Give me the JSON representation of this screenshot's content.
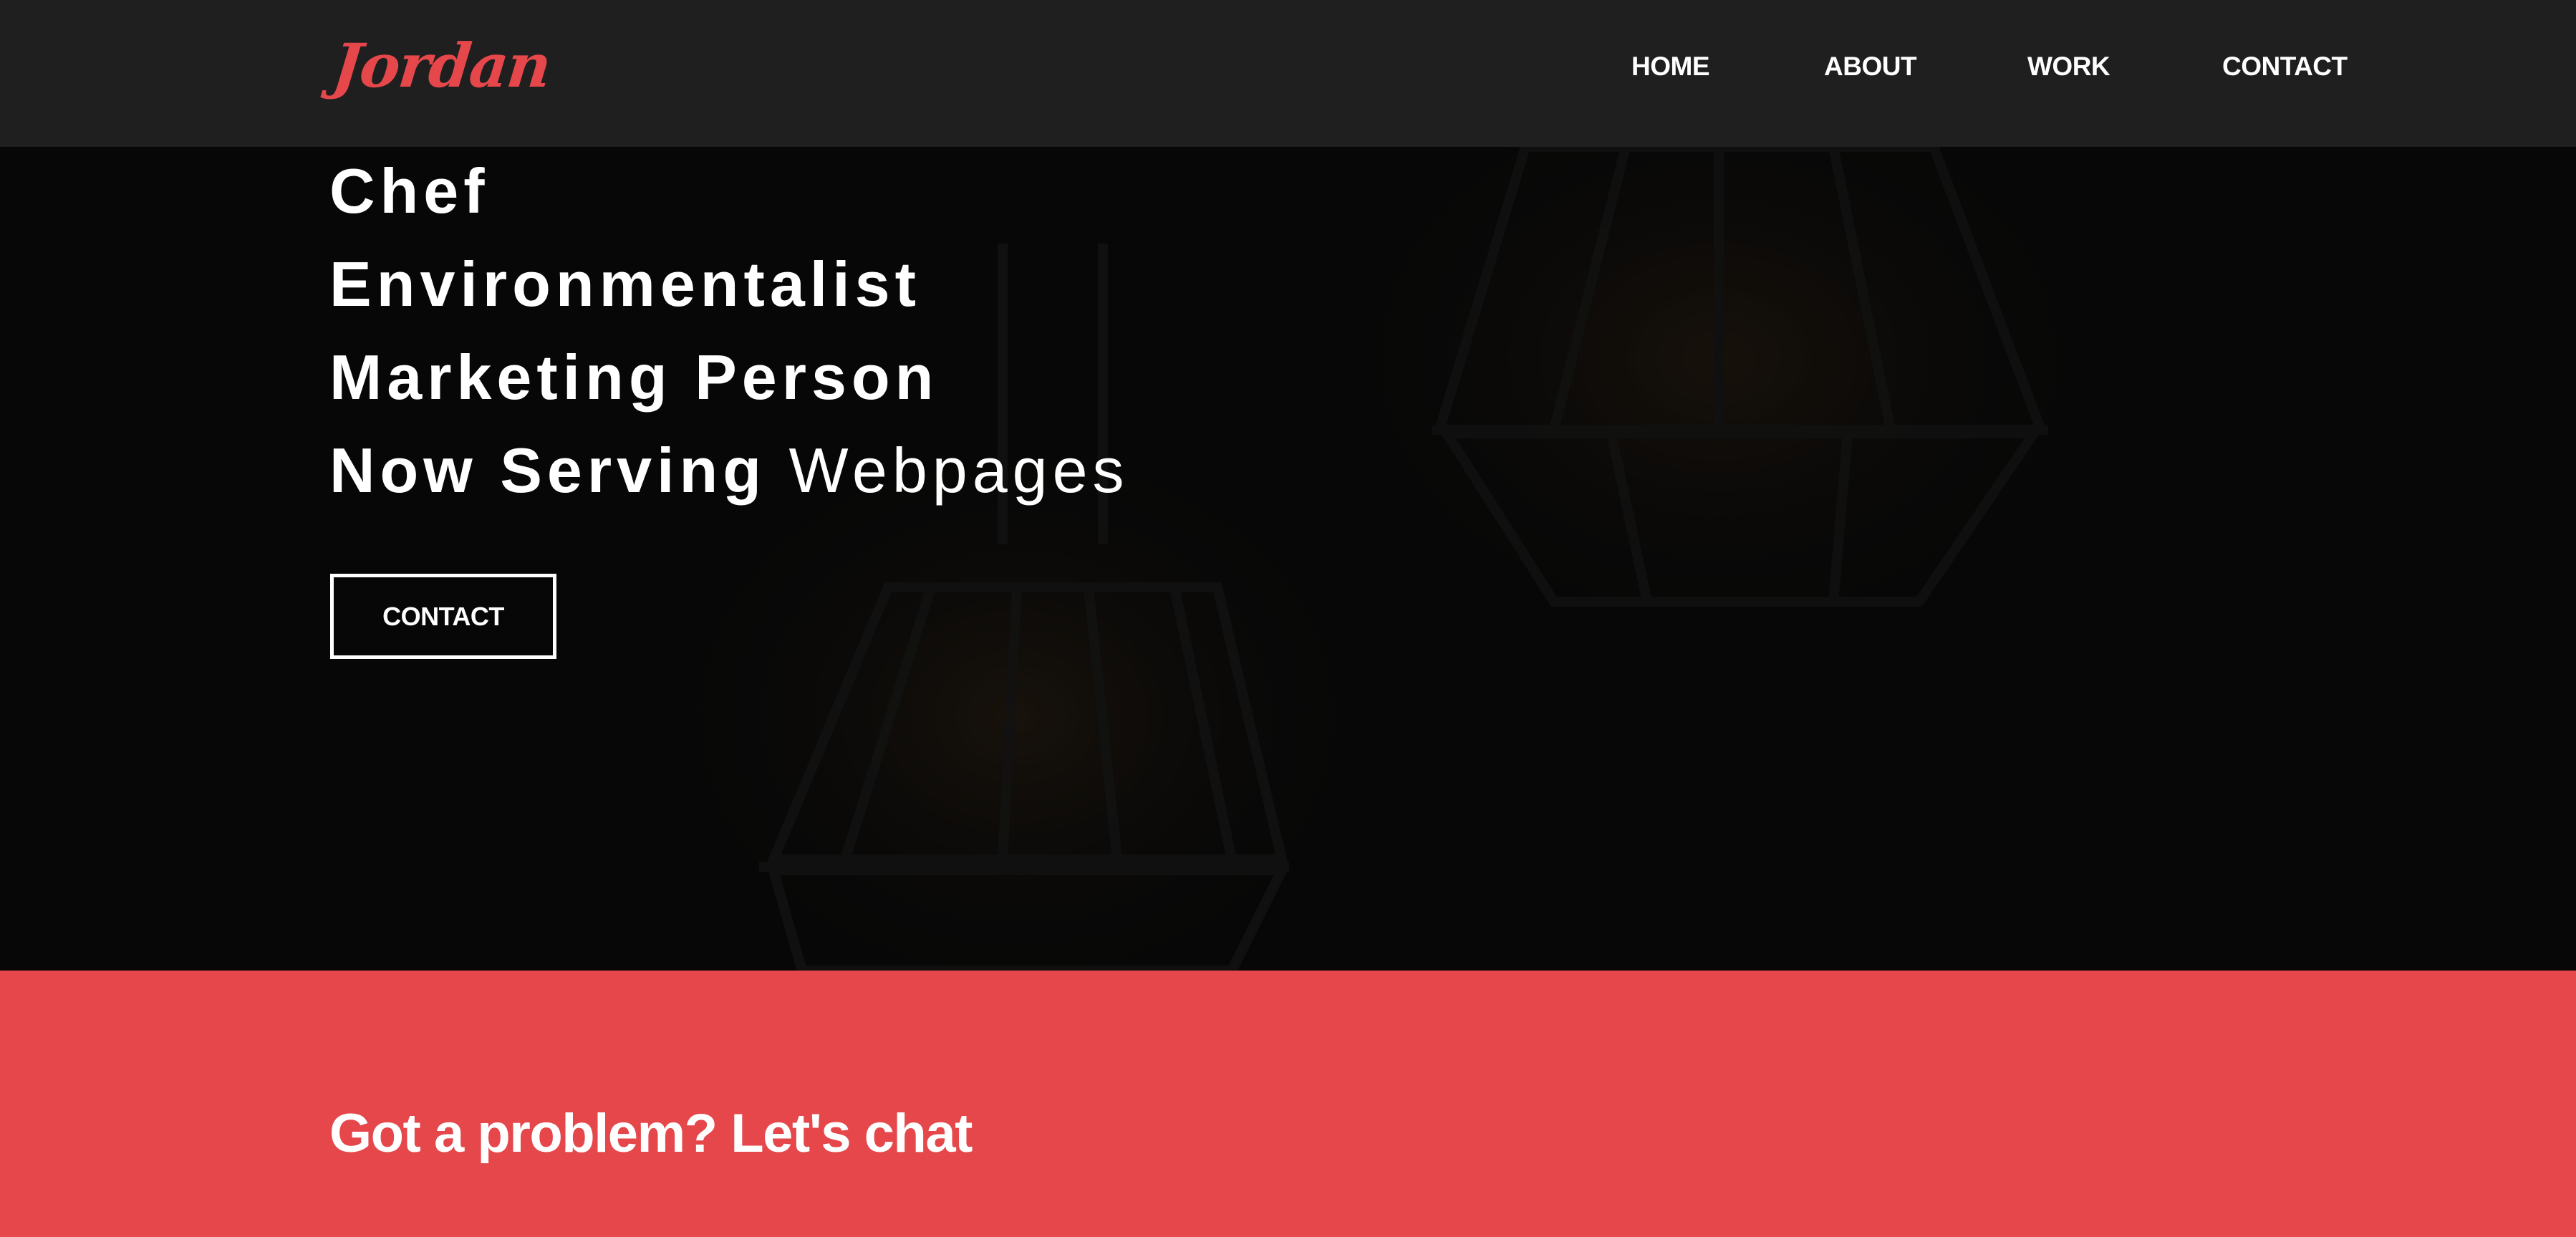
{
  "nav": {
    "logo": "Jordan",
    "items": [
      "HOME",
      "ABOUT",
      "WORK",
      "CONTACT"
    ]
  },
  "hero": {
    "roles": [
      {
        "bold": "Chef",
        "light": ""
      },
      {
        "bold": "Environmentalist",
        "light": ""
      },
      {
        "bold": "Marketing Person",
        "light": ""
      },
      {
        "bold": "Now Serving",
        "light": "Webpages"
      }
    ],
    "contact_button": "CONTACT"
  },
  "chat": {
    "heading": "Got a problem? Let's chat"
  },
  "colors": {
    "accent": "#e5474b",
    "navbar": "#1f1f1f",
    "hero_background": "#0c0c0c",
    "text": "#ffffff"
  }
}
